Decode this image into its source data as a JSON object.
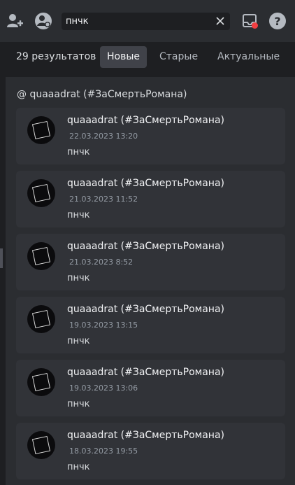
{
  "toolbar": {
    "search": {
      "value": "пнчк",
      "placeholder": ""
    },
    "icons": [
      "add-friend-icon",
      "members-icon",
      "inbox-icon",
      "help-icon"
    ]
  },
  "results": {
    "count_label": "29 результатов",
    "tabs": [
      {
        "label": "Новые",
        "active": true
      },
      {
        "label": "Старые",
        "active": false
      },
      {
        "label": "Актуальные",
        "active": false
      }
    ],
    "channel_header": "@ quaaadrat (#ЗаСмертьРомана)",
    "items": [
      {
        "author": "quaaadrat (#ЗаСмертьРомана)",
        "timestamp": "22.03.2023 13:20",
        "content": "пнчк"
      },
      {
        "author": "quaaadrat (#ЗаСмертьРомана)",
        "timestamp": "21.03.2023 11:52",
        "content": "пнчк"
      },
      {
        "author": "quaaadrat (#ЗаСмертьРомана)",
        "timestamp": "21.03.2023 8:52",
        "content": "пнчк"
      },
      {
        "author": "quaaadrat (#ЗаСмертьРомана)",
        "timestamp": "19.03.2023 13:15",
        "content": "пнчк"
      },
      {
        "author": "quaaadrat (#ЗаСмертьРомана)",
        "timestamp": "19.03.2023 13:06",
        "content": "пнчк"
      },
      {
        "author": "quaaadrat (#ЗаСмертьРомана)",
        "timestamp": "18.03.2023 19:55",
        "content": "пнчк"
      }
    ]
  },
  "colors": {
    "background": "#1e1f22",
    "panel": "#2b2d31",
    "card": "#313338",
    "active_tab": "#404249",
    "icon": "#b5bac1",
    "notification_red": "#f23f42"
  }
}
